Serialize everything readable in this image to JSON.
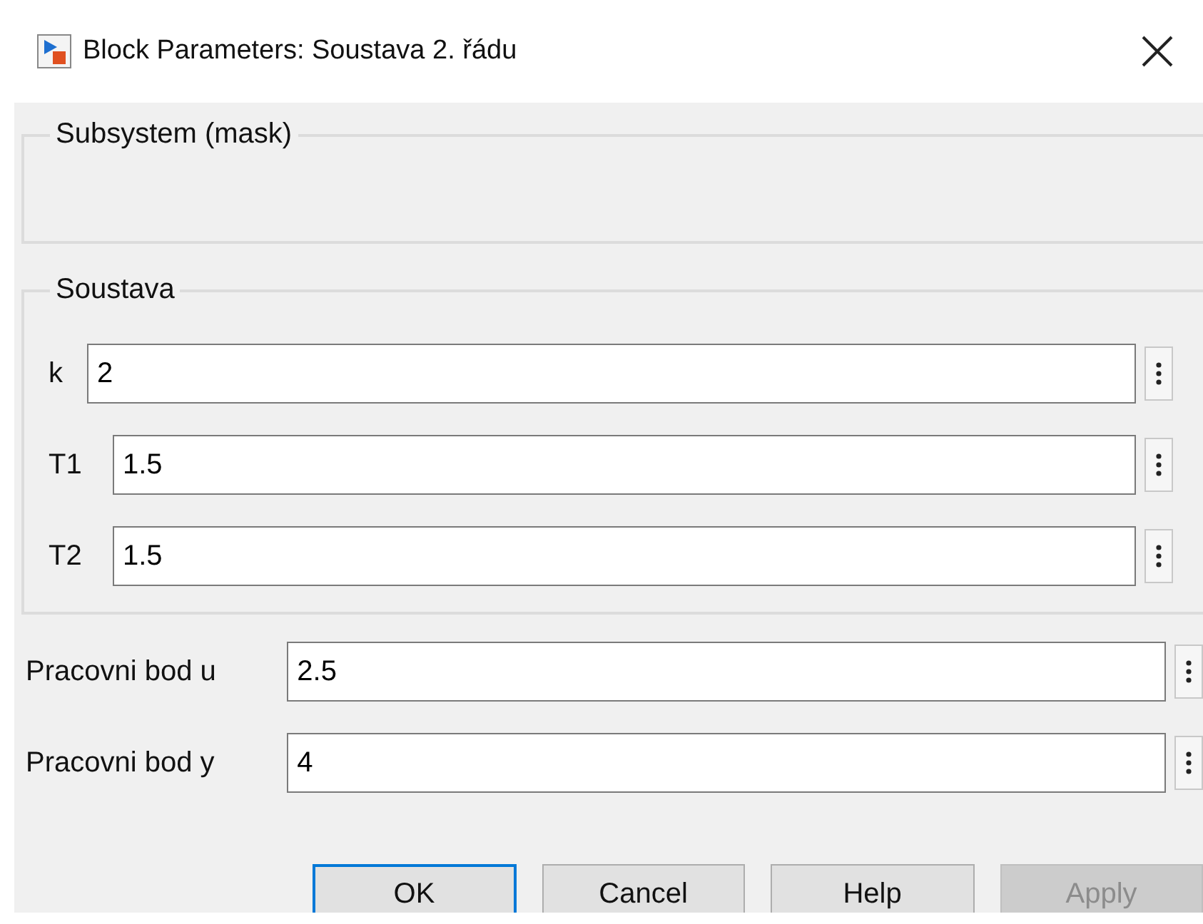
{
  "window": {
    "title": "Block Parameters: Soustava 2. řádu"
  },
  "groups": [
    {
      "title": "Subsystem (mask)"
    },
    {
      "title": "Soustava",
      "parameters": [
        {
          "label": "k",
          "value": "2"
        },
        {
          "label": "T1",
          "value": "1.5"
        },
        {
          "label": "T2",
          "value": "1.5"
        }
      ]
    }
  ],
  "parameters": [
    {
      "label": "Pracovni bod u",
      "value": "2.5"
    },
    {
      "label": "Pracovni bod y",
      "value": "4"
    }
  ],
  "buttons": [
    {
      "label": "OK",
      "default": true,
      "disabled": false
    },
    {
      "label": "Cancel",
      "default": false,
      "disabled": false
    },
    {
      "label": "Help",
      "default": false,
      "disabled": false
    },
    {
      "label": "Apply",
      "default": false,
      "disabled": true
    }
  ]
}
